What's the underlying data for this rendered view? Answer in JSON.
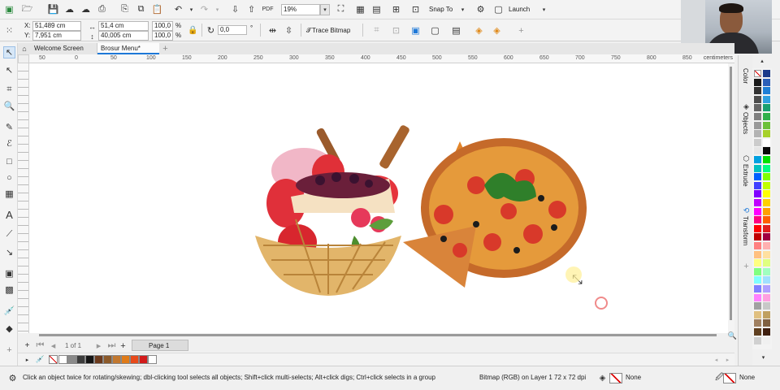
{
  "toolbar": {
    "zoom_value": "19%",
    "snap_to_label": "Snap To",
    "launch_label": "Launch"
  },
  "propbar": {
    "x_label": "X:",
    "x_value": "51,489 cm",
    "y_label": "Y:",
    "y_value": "7,951 cm",
    "width_value": "51,4 cm",
    "height_value": "40,005 cm",
    "scale_x": "100,0",
    "scale_y": "100,0",
    "percent": "%",
    "angle_value": "0,0",
    "degree": "°",
    "trace_bitmap_label": "Trace Bitmap"
  },
  "tabs": [
    {
      "label": "Welcome Screen"
    },
    {
      "label": "Brosur Menu*"
    }
  ],
  "ruler": {
    "unit": "centimeters",
    "ticks": [
      "50",
      "0",
      "50",
      "100",
      "150",
      "200",
      "250",
      "300",
      "350",
      "400",
      "450",
      "500",
      "550",
      "600",
      "650",
      "700",
      "750",
      "800",
      "850"
    ]
  },
  "dockers": [
    {
      "label": "Color"
    },
    {
      "label": "Objects"
    },
    {
      "label": "Extrude"
    },
    {
      "label": "Transform"
    }
  ],
  "page_nav": {
    "page_count": "1 of 1",
    "page_tab": "Page 1"
  },
  "status": {
    "hint": "Click an object twice for rotating/skewing; dbl-clicking tool selects all objects; Shift+click multi-selects; Alt+click digs; Ctrl+click selects in a group",
    "object_info": "Bitmap (RGB) on Layer 1 72 x 72 dpi",
    "fill_label": "None",
    "outline_label": "None"
  },
  "colors": {
    "accent": "#1e78d7",
    "canvas": "#ffffff",
    "workspace": "#f0f0f0"
  },
  "document_palette": [
    "#ffffff",
    "#8a8a8a",
    "#3c3c3c",
    "#151515",
    "#6b3a1d",
    "#8c5a2a",
    "#c2782f",
    "#e07b18",
    "#e84a1a",
    "#d21a1a",
    "#ffffff"
  ],
  "color_palette": [
    [
      "#000000",
      "#1a3a8a"
    ],
    [
      "#1a1a1a",
      "#2b5fb8"
    ],
    [
      "#333333",
      "#1f7fd6"
    ],
    [
      "#4d4d4d",
      "#30a0e0"
    ],
    [
      "#666666",
      "#1aa070"
    ],
    [
      "#808080",
      "#2fb04a"
    ],
    [
      "#999999",
      "#6cc13a"
    ],
    [
      "#b3b3b3",
      "#a6d12a"
    ],
    [
      "#cccccc",
      "#ffffff"
    ],
    [
      "#e6e6e6",
      "#0a0a0a"
    ],
    [
      "#00a0e0",
      "#00e000"
    ],
    [
      "#00c0c0",
      "#00ff80"
    ],
    [
      "#0060ff",
      "#80ff00"
    ],
    [
      "#4040ff",
      "#c0ff00"
    ],
    [
      "#8000ff",
      "#ffff00"
    ],
    [
      "#c000ff",
      "#ffd000"
    ],
    [
      "#ff00ff",
      "#ffa000"
    ],
    [
      "#ff0080",
      "#ff6000"
    ],
    [
      "#ff0000",
      "#e02020"
    ],
    [
      "#c00000",
      "#a00040"
    ],
    [
      "#ff8080",
      "#ffb0b0"
    ],
    [
      "#ffc080",
      "#ffe0a0"
    ],
    [
      "#ffff80",
      "#e0ff80"
    ],
    [
      "#80ff80",
      "#a0ffc0"
    ],
    [
      "#80ffff",
      "#a0e0ff"
    ],
    [
      "#8080ff",
      "#b0a0ff"
    ],
    [
      "#ff80ff",
      "#ffa0e0"
    ],
    [
      "#a0a0a0",
      "#c8c8c8"
    ],
    [
      "#e0c080",
      "#c0a060"
    ],
    [
      "#a08060",
      "#806040"
    ],
    [
      "#604020",
      "#402010"
    ],
    [
      "#d0d0d0",
      "#f0f0f0"
    ]
  ]
}
